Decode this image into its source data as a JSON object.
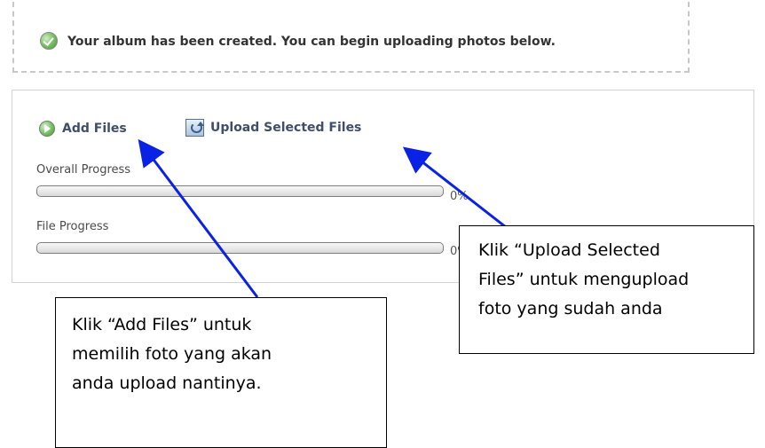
{
  "status": {
    "icon": "success-check-icon",
    "message": "Your album has been created. You can begin uploading photos below."
  },
  "toolbar": {
    "add_files": {
      "icon": "add-circle-icon",
      "label": "Add Files"
    },
    "upload_selected": {
      "icon": "upload-icon",
      "label": "Upload Selected Files"
    }
  },
  "progress": {
    "overall": {
      "label": "Overall Progress",
      "value": 0,
      "text": "0%"
    },
    "file": {
      "label": "File Progress",
      "value": 0,
      "text": "0%"
    }
  },
  "annotations": {
    "upload_callout": {
      "lines": [
        "Klik “Upload Selected",
        "Files” untuk mengupload",
        "foto yang sudah anda"
      ]
    },
    "add_callout": {
      "lines": [
        "Klik “Add Files” untuk",
        "memilih foto yang akan",
        "anda upload nantinya."
      ]
    }
  },
  "colors": {
    "arrow": "#0a22e6",
    "link_text": "#3f4f6b",
    "success_green": "#4aa436"
  }
}
